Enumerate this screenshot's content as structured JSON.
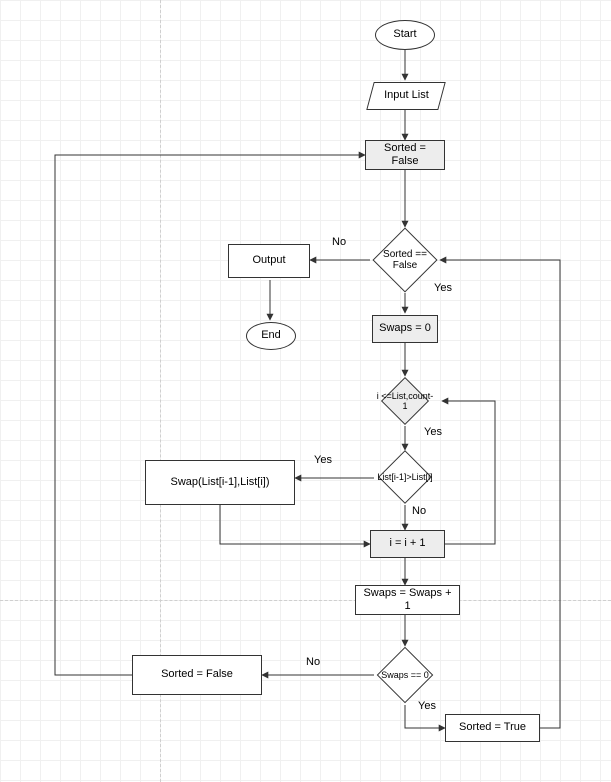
{
  "chart_data": {
    "type": "flowchart",
    "title": "",
    "nodes": [
      {
        "id": "start",
        "shape": "terminator",
        "label": "Start"
      },
      {
        "id": "input",
        "shape": "io",
        "label": "Input  List"
      },
      {
        "id": "sorted_false",
        "shape": "process-grey",
        "label": "Sorted = False"
      },
      {
        "id": "cond_sorted",
        "shape": "decision",
        "label": "Sorted == False"
      },
      {
        "id": "output",
        "shape": "process",
        "label": "Output"
      },
      {
        "id": "end",
        "shape": "terminator",
        "label": "End"
      },
      {
        "id": "swaps0",
        "shape": "process-grey",
        "label": "Swaps = 0"
      },
      {
        "id": "cond_i",
        "shape": "decision-grey",
        "label": "i <=List,count-1"
      },
      {
        "id": "cond_cmp",
        "shape": "decision",
        "label": "List[i-1]>List[i]"
      },
      {
        "id": "swap",
        "shape": "process",
        "label": "Swap(List[i-1],List[i])"
      },
      {
        "id": "inc_i",
        "shape": "process-grey",
        "label": "i = i + 1"
      },
      {
        "id": "inc_swaps",
        "shape": "process",
        "label": "Swaps =  Swaps + 1"
      },
      {
        "id": "cond_swaps0",
        "shape": "decision",
        "label": "Swaps == 0"
      },
      {
        "id": "set_false",
        "shape": "process",
        "label": "Sorted = False"
      },
      {
        "id": "set_true",
        "shape": "process",
        "label": "Sorted = True"
      }
    ],
    "edges": [
      {
        "from": "start",
        "to": "input",
        "label": ""
      },
      {
        "from": "input",
        "to": "sorted_false",
        "label": ""
      },
      {
        "from": "sorted_false",
        "to": "cond_sorted",
        "label": ""
      },
      {
        "from": "cond_sorted",
        "to": "output",
        "label": "No"
      },
      {
        "from": "cond_sorted",
        "to": "swaps0",
        "label": "Yes"
      },
      {
        "from": "output",
        "to": "end",
        "label": ""
      },
      {
        "from": "swaps0",
        "to": "cond_i",
        "label": ""
      },
      {
        "from": "cond_i",
        "to": "cond_cmp",
        "label": "Yes"
      },
      {
        "from": "cond_cmp",
        "to": "swap",
        "label": "Yes"
      },
      {
        "from": "cond_cmp",
        "to": "inc_i",
        "label": "No"
      },
      {
        "from": "swap",
        "to": "inc_i",
        "label": ""
      },
      {
        "from": "inc_i",
        "to": "cond_i",
        "label": ""
      },
      {
        "from": "inc_i",
        "to": "inc_swaps",
        "label": ""
      },
      {
        "from": "inc_swaps",
        "to": "cond_swaps0",
        "label": ""
      },
      {
        "from": "cond_swaps0",
        "to": "set_false",
        "label": "No"
      },
      {
        "from": "cond_swaps0",
        "to": "set_true",
        "label": "Yes"
      },
      {
        "from": "set_false",
        "to": "sorted_false",
        "label": ""
      },
      {
        "from": "set_true",
        "to": "cond_sorted",
        "label": ""
      }
    ]
  },
  "nodes": {
    "start": "Start",
    "input": "Input  List",
    "sorted_false": "Sorted = False",
    "cond_sorted": "Sorted == False",
    "output": "Output",
    "end": "End",
    "swaps0": "Swaps = 0",
    "cond_i": "i <=List,count-1",
    "cond_cmp": "List[i-1]>List[i]",
    "swap": "Swap(List[i-1],List[i])",
    "inc_i": "i = i + 1",
    "inc_swaps": "Swaps =  Swaps + 1",
    "cond_swaps0": "Swaps == 0",
    "set_false": "Sorted = False",
    "set_true": "Sorted = True"
  },
  "labels": {
    "no": "No",
    "yes": "Yes"
  }
}
